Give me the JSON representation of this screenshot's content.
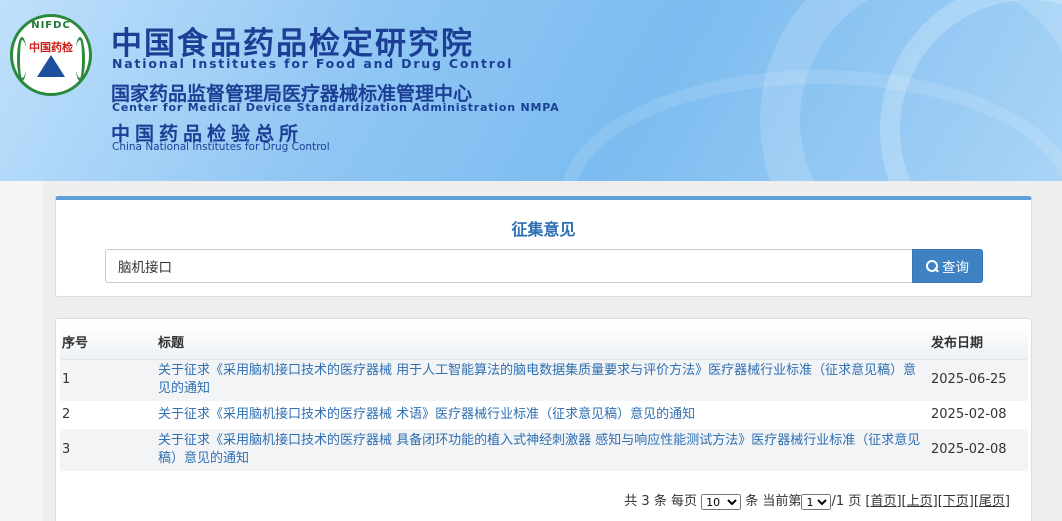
{
  "header": {
    "logo_ring_text": "NIFDC",
    "logo_cn_text": "中国药检",
    "title_cn": "中国食品药品检定研究院",
    "title_en": "National Institutes for Food and Drug Control",
    "subtitle_cn": "国家药品监督管理局医疗器械标准管理中心",
    "subtitle_en": "Center for Medical Device Standardization Administration NMPA",
    "third_cn": "中国药品检验总所",
    "third_en": "China National Institutes for Drug Control"
  },
  "search": {
    "panel_title": "征集意见",
    "value": "脑机接口",
    "button_label": "查询"
  },
  "table": {
    "headers": [
      "序号",
      "标题",
      "发布日期"
    ],
    "rows": [
      {
        "index": "1",
        "title": "关于征求《采用脑机接口技术的医疗器械 用于人工智能算法的脑电数据集质量要求与评价方法》医疗器械行业标准（征求意见稿）意见的通知",
        "date": "2025-06-25"
      },
      {
        "index": "2",
        "title": "关于征求《采用脑机接口技术的医疗器械 术语》医疗器械行业标准（征求意见稿）意见的通知",
        "date": "2025-02-08"
      },
      {
        "index": "3",
        "title": "关于征求《采用脑机接口技术的医疗器械 具备闭环功能的植入式神经刺激器 感知与响应性能测试方法》医疗器械行业标准（征求意见稿）意见的通知",
        "date": "2025-02-08"
      }
    ]
  },
  "pager": {
    "total_prefix": "共",
    "total": "3",
    "total_unit": "条",
    "per_page_label": "每页",
    "per_page_value": "10",
    "per_page_unit": "条",
    "current_label": "当前第",
    "current_page": "1",
    "page_total": "/1 页",
    "first": "[首页]",
    "prev": "[上页]",
    "next": "[下页]",
    "last": "[尾页]"
  },
  "colors": {
    "brand_blue": "#1c3f96",
    "link_blue": "#2f6fb2",
    "button_blue": "#3f82c4",
    "panel_top_border": "#5f9ed8"
  },
  "icons": {
    "search_button_icon": "search-icon",
    "logo": "nifdc-logo-icon"
  }
}
